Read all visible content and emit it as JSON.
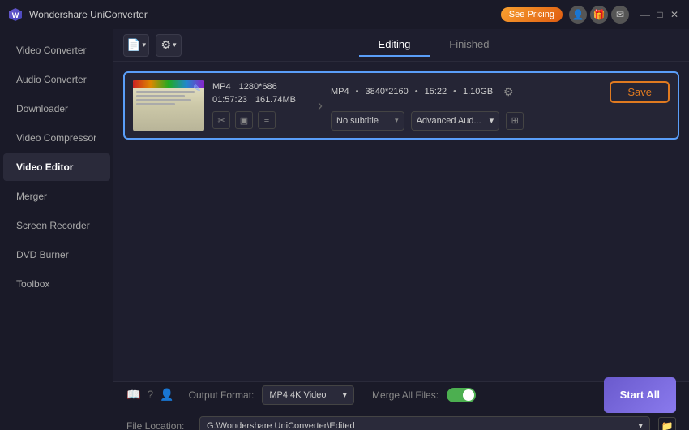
{
  "app": {
    "name": "Wondershare UniConverter",
    "logo_text": "W"
  },
  "title_bar": {
    "pricing_btn": "See Pricing",
    "window_controls": [
      "—",
      "□",
      "✕"
    ]
  },
  "sidebar": {
    "items": [
      {
        "id": "video-converter",
        "label": "Video Converter",
        "active": false
      },
      {
        "id": "audio-converter",
        "label": "Audio Converter",
        "active": false
      },
      {
        "id": "downloader",
        "label": "Downloader",
        "active": false
      },
      {
        "id": "video-compressor",
        "label": "Video Compressor",
        "active": false
      },
      {
        "id": "video-editor",
        "label": "Video Editor",
        "active": true
      },
      {
        "id": "merger",
        "label": "Merger",
        "active": false
      },
      {
        "id": "screen-recorder",
        "label": "Screen Recorder",
        "active": false
      },
      {
        "id": "dvd-burner",
        "label": "DVD Burner",
        "active": false
      },
      {
        "id": "toolbox",
        "label": "Toolbox",
        "active": false
      }
    ]
  },
  "toolbar": {
    "add_btn_title": "Add File",
    "settings_btn_title": "Settings"
  },
  "tabs": [
    {
      "id": "editing",
      "label": "Editing",
      "active": true
    },
    {
      "id": "finished",
      "label": "Finished",
      "active": false
    }
  ],
  "video_card": {
    "input": {
      "format": "MP4",
      "resolution": "1280*686",
      "duration": "01:57:23",
      "filesize": "161.74MB"
    },
    "output": {
      "format": "MP4",
      "resolution": "3840*2160",
      "duration": "15:22",
      "filesize": "1.10GB"
    },
    "subtitle": "No subtitle",
    "audio": "Advanced Aud...",
    "save_btn": "Save"
  },
  "bottom_bar": {
    "output_format_label": "Output Format:",
    "output_format_value": "MP4 4K Video",
    "merge_label": "Merge All Files:",
    "file_location_label": "File Location:",
    "file_location_value": "G:\\Wondershare UniConverter\\Edited",
    "start_all_btn": "Start All"
  },
  "tool_icons": {
    "cut": "✂",
    "crop": "▣",
    "subtitles": "≡",
    "gear": "⚙",
    "subtitle_add": "⊞"
  }
}
